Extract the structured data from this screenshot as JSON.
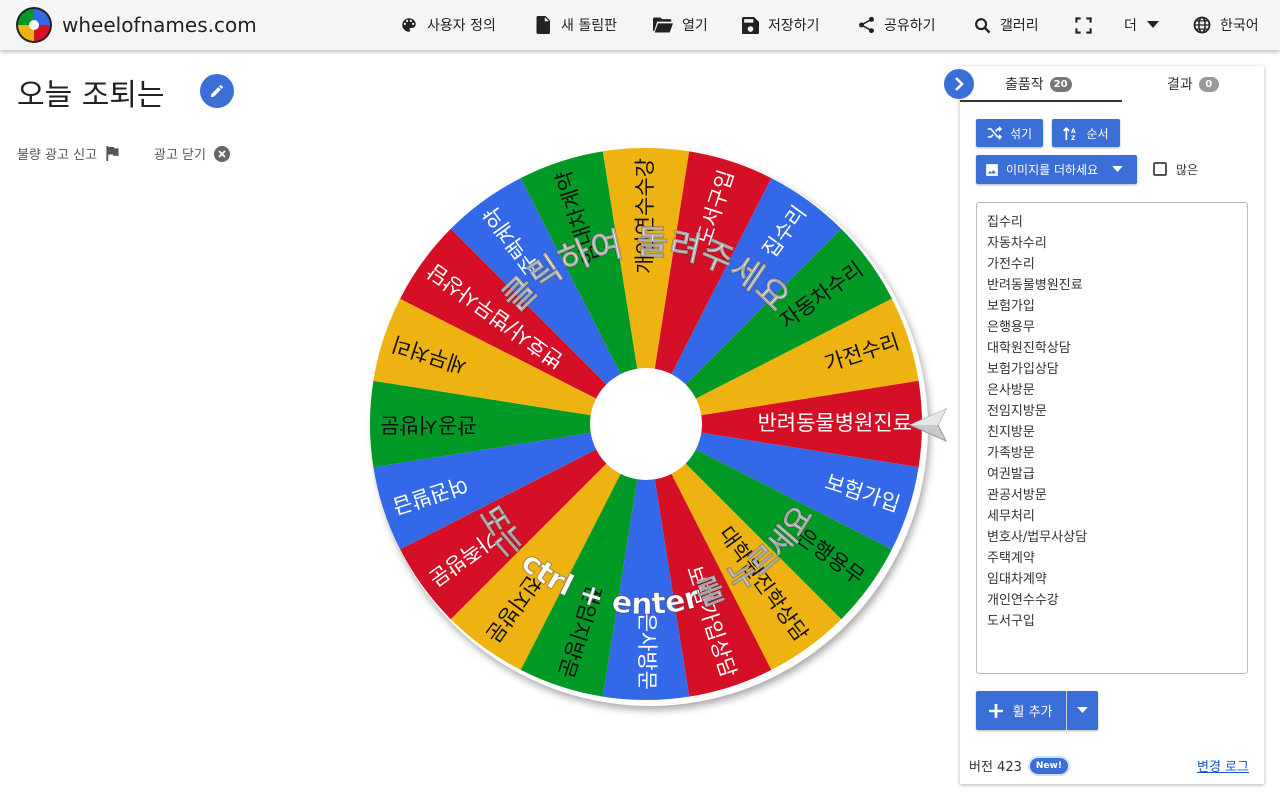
{
  "header": {
    "brand": "wheelofnames.com",
    "nav": [
      {
        "label": "사용자 정의",
        "icon": "palette-icon"
      },
      {
        "label": "새 돌림판",
        "icon": "new-file-icon"
      },
      {
        "label": "열기",
        "icon": "folder-open-icon"
      },
      {
        "label": "저장하기",
        "icon": "save-icon"
      },
      {
        "label": "공유하기",
        "icon": "share-icon"
      },
      {
        "label": "갤러리",
        "icon": "search-icon"
      },
      {
        "label": "",
        "icon": "fullscreen-icon"
      },
      {
        "label": "더",
        "icon": "chevron-down-icon"
      },
      {
        "label": "한국어",
        "icon": "globe-icon"
      }
    ]
  },
  "title": "오늘 조퇴는",
  "ads": {
    "report": "불량 광고 신고",
    "close": "광고 닫기"
  },
  "wheel": {
    "colors": [
      "#3369e8",
      "#009925",
      "#eeb211",
      "#d50f25"
    ],
    "instruction_line1": "클릭하여 돌려주세요",
    "instruction_line2": "또는 ctrl + enter를 누르세요",
    "pointer_label": "반려동물병원진료"
  },
  "panel": {
    "tabs": [
      {
        "label": "출품작",
        "count": "20"
      },
      {
        "label": "결과",
        "count": "0"
      }
    ],
    "shuffle": "섞기",
    "sort": "순서",
    "add_image": "이미지를 더하세요",
    "advanced": "많은",
    "entries": [
      "집수리",
      "자동차수리",
      "가전수리",
      "반려동물병원진료",
      "보험가입",
      "은행용무",
      "대학원진학상담",
      "보험가입상담",
      "은사방문",
      "전임지방문",
      "친지방문",
      "가족방문",
      "여권발급",
      "관공서방문",
      "세무처리",
      "변호사/법무사상담",
      "주택계약",
      "임대차계약",
      "개인연수수강",
      "도서구입"
    ],
    "add_wheel": "휠 추가",
    "version": "버전 423",
    "new_badge": "New!",
    "changelog": "변경 로그"
  }
}
